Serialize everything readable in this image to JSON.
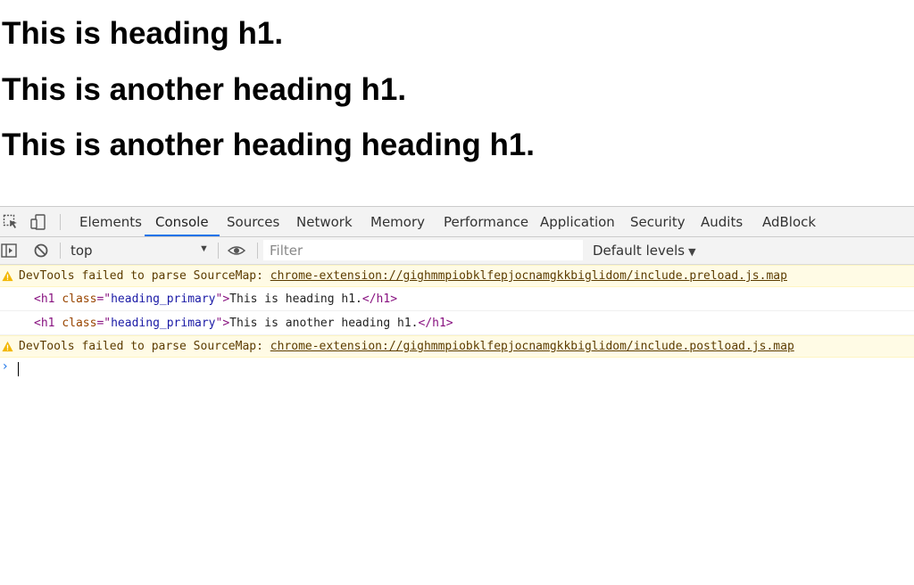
{
  "page": {
    "headings": [
      "This is heading h1.",
      "This is another heading h1.",
      "This is another heading heading h1."
    ]
  },
  "devtools": {
    "tabs": [
      "Elements",
      "Console",
      "Sources",
      "Network",
      "Memory",
      "Performance",
      "Application",
      "Security",
      "Audits",
      "AdBlock"
    ],
    "active_tab": "Console",
    "toolbar": {
      "context": "top",
      "filter_placeholder": "Filter",
      "levels_label": "Default levels"
    },
    "console": {
      "warning1": {
        "text": "DevTools failed to parse SourceMap: ",
        "link": "chrome-extension://gighmmpiobklfepjocnamgkkbiglidom/include.preload.js.map"
      },
      "log1": {
        "open_tag": "<h1",
        "attr_name": "class",
        "eq_quote": "=\"",
        "attr_value": "heading_primary",
        "close_quote": "\">",
        "text": "This is heading h1.",
        "end_tag": "</h1>"
      },
      "log2": {
        "open_tag": "<h1",
        "attr_name": "class",
        "eq_quote": "=\"",
        "attr_value": "heading_primary",
        "close_quote": "\">",
        "text": "This is another heading h1.",
        "end_tag": "</h1>"
      },
      "warning2": {
        "text": "DevTools failed to parse SourceMap: ",
        "link": "chrome-extension://gighmmpiobklfepjocnamgkkbiglidom/include.postload.js.map"
      }
    }
  },
  "colors": {
    "accent": "#1a73e8",
    "warning_bg": "#fffbe5",
    "warning_text": "#5c3c00"
  }
}
